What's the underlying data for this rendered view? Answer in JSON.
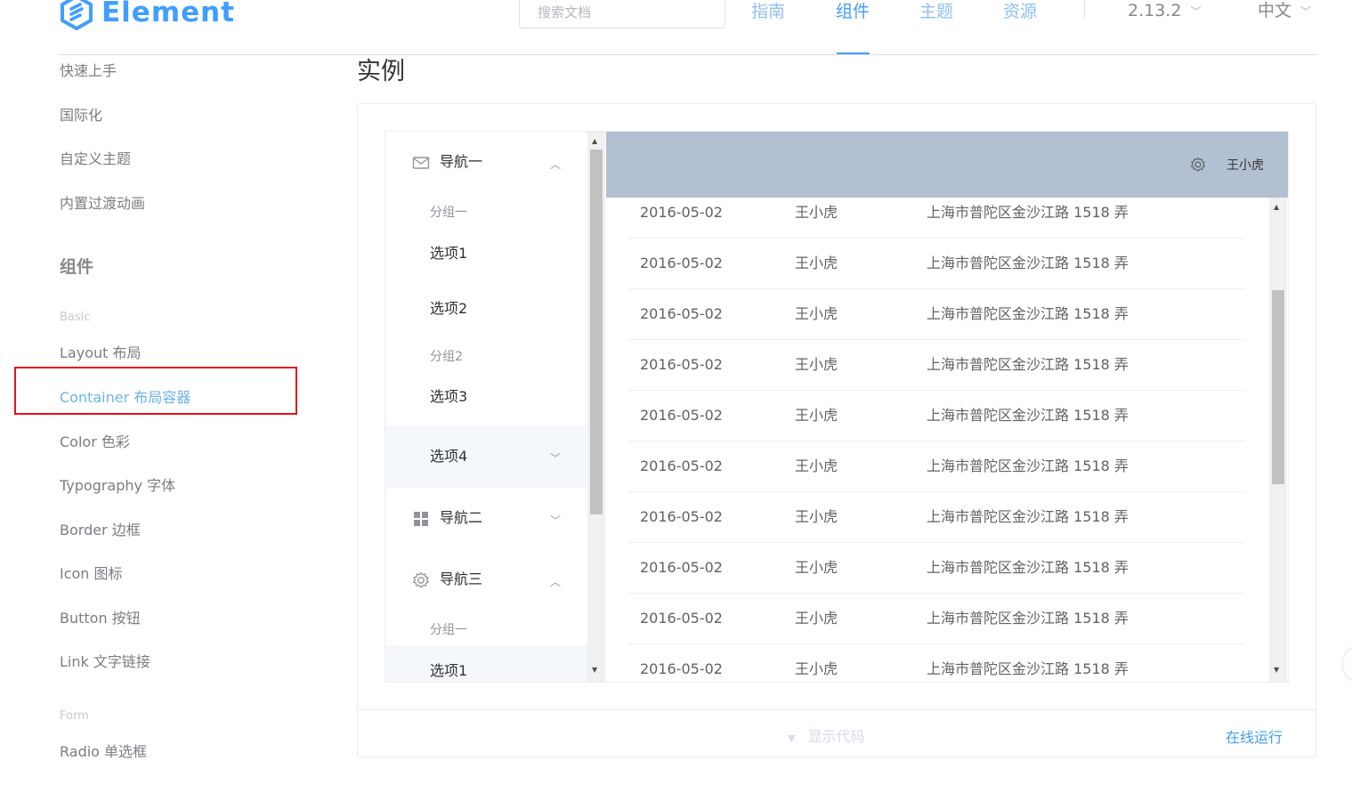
{
  "header": {
    "logo_text": "Element",
    "search_placeholder": "搜索文档",
    "nav": [
      "指南",
      "组件",
      "主题",
      "资源"
    ],
    "active_nav": "组件",
    "version": "2.13.2",
    "language": "中文"
  },
  "sidebar": {
    "items_top": [
      "快速上手",
      "国际化",
      "自定义主题",
      "内置过渡动画"
    ],
    "section_title": "组件",
    "group_basic": "Basic",
    "basic_items": [
      "Layout 布局",
      "Container 布局容器",
      "Color 色彩",
      "Typography 字体",
      "Border 边框",
      "Icon 图标",
      "Button 按钮",
      "Link 文字链接"
    ],
    "active_item": "Container 布局容器",
    "group_form": "Form",
    "form_items": [
      "Radio 单选框"
    ]
  },
  "main": {
    "title": "实例",
    "show_code": "显示代码",
    "run_online": "在线运行"
  },
  "demo": {
    "menu": {
      "nav1": "导航一",
      "group1": "分组一",
      "option1": "选项1",
      "option2": "选项2",
      "group2": "分组2",
      "option3": "选项3",
      "option4": "选项4",
      "nav2": "导航二",
      "nav3": "导航三",
      "nav3_group1": "分组一",
      "nav3_option1": "选项1"
    },
    "header_user": "王小虎",
    "rows": [
      {
        "date": "2016-05-02",
        "name": "王小虎",
        "address": "上海市普陀区金沙江路 1518 弄"
      },
      {
        "date": "2016-05-02",
        "name": "王小虎",
        "address": "上海市普陀区金沙江路 1518 弄"
      },
      {
        "date": "2016-05-02",
        "name": "王小虎",
        "address": "上海市普陀区金沙江路 1518 弄"
      },
      {
        "date": "2016-05-02",
        "name": "王小虎",
        "address": "上海市普陀区金沙江路 1518 弄"
      },
      {
        "date": "2016-05-02",
        "name": "王小虎",
        "address": "上海市普陀区金沙江路 1518 弄"
      },
      {
        "date": "2016-05-02",
        "name": "王小虎",
        "address": "上海市普陀区金沙江路 1518 弄"
      },
      {
        "date": "2016-05-02",
        "name": "王小虎",
        "address": "上海市普陀区金沙江路 1518 弄"
      },
      {
        "date": "2016-05-02",
        "name": "王小虎",
        "address": "上海市普陀区金沙江路 1518 弄"
      },
      {
        "date": "2016-05-02",
        "name": "王小虎",
        "address": "上海市普陀区金沙江路 1518 弄"
      },
      {
        "date": "2016-05-02",
        "name": "王小虎",
        "address": "上海市普陀区金沙江路 1518 弄"
      }
    ]
  },
  "colors": {
    "accent": "#409eff",
    "header_bg": "#b3c0d1",
    "highlight_border": "#e8101a"
  }
}
